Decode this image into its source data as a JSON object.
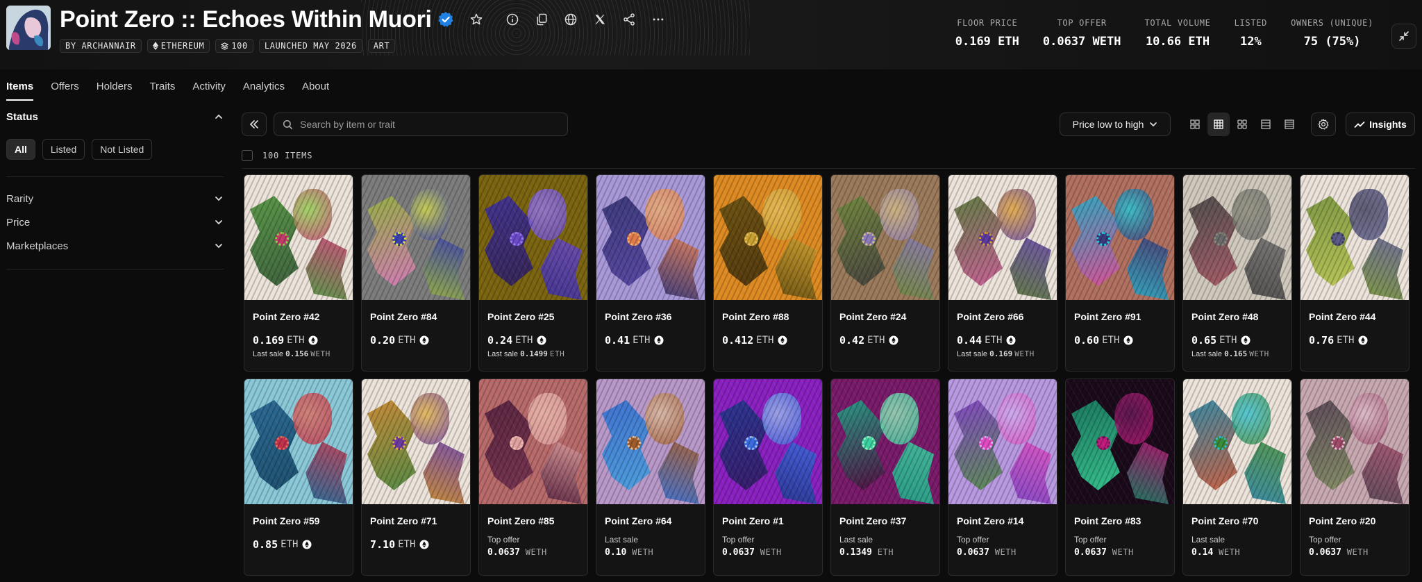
{
  "collection": {
    "title": "Point Zero :: Echoes Within Muori",
    "tags": [
      {
        "label": "BY ARCHANNAIR",
        "icon": ""
      },
      {
        "label": "ETHEREUM",
        "icon": "ethereum-icon"
      },
      {
        "label": "100",
        "icon": "stack-icon"
      },
      {
        "label": "LAUNCHED MAY 2026",
        "icon": ""
      },
      {
        "label": "ART",
        "icon": ""
      }
    ]
  },
  "stats": [
    {
      "label": "FLOOR PRICE",
      "value": "0.169 ETH"
    },
    {
      "label": "TOP OFFER",
      "value": "0.0637 WETH"
    },
    {
      "label": "TOTAL VOLUME",
      "value": "10.66 ETH"
    },
    {
      "label": "LISTED",
      "value": "12%"
    },
    {
      "label": "OWNERS (UNIQUE)",
      "value": "75 (75%)"
    }
  ],
  "tabs": [
    "Items",
    "Offers",
    "Holders",
    "Traits",
    "Activity",
    "Analytics",
    "About"
  ],
  "active_tab": "Items",
  "sidebar": {
    "status_title": "Status",
    "status_chips": [
      "All",
      "Listed",
      "Not Listed"
    ],
    "active_chip": "All",
    "filters": [
      "Rarity",
      "Price",
      "Marketplaces"
    ]
  },
  "toolbar": {
    "search_placeholder": "Search by item or trait",
    "sort_label": "Price low to high",
    "insights_label": "Insights",
    "items_count": "100 ITEMS"
  },
  "items": [
    {
      "name": "Point Zero #42",
      "kind": "listed",
      "price": "0.169",
      "unit": "ETH",
      "sub_label": "Last sale",
      "sub_value": "0.156",
      "sub_unit": "WETH",
      "palette": [
        "#ece3da",
        "#3f8a2e",
        "#c23a6a",
        "#1f4a22",
        "#8fd04a"
      ]
    },
    {
      "name": "Point Zero #84",
      "kind": "listed",
      "price": "0.20",
      "unit": "ETH",
      "palette": [
        "#7c7c7c",
        "#9ab83a",
        "#3a3fb0",
        "#e07ac0",
        "#d8e04a"
      ]
    },
    {
      "name": "Point Zero #25",
      "kind": "listed",
      "price": "0.24",
      "unit": "ETH",
      "sub_label": "Last sale",
      "sub_value": "0.1499",
      "sub_unit": "ETH",
      "palette": [
        "#7a6410",
        "#3a2ca8",
        "#6a4ac8",
        "#2a1a60",
        "#9a7cf0"
      ]
    },
    {
      "name": "Point Zero #36",
      "kind": "listed",
      "price": "0.41",
      "unit": "ETH",
      "palette": [
        "#a898d8",
        "#2a2a6a",
        "#e07a4a",
        "#4a3a9a",
        "#f0b070"
      ]
    },
    {
      "name": "Point Zero #88",
      "kind": "listed",
      "price": "0.412",
      "unit": "ETH",
      "palette": [
        "#de8a22",
        "#5a4a10",
        "#c8a030",
        "#3a2a0a",
        "#e8c060"
      ]
    },
    {
      "name": "Point Zero #24",
      "kind": "listed",
      "price": "0.42",
      "unit": "ETH",
      "palette": [
        "#9a7a5a",
        "#6a8a3a",
        "#8a7ab8",
        "#3a3a3a",
        "#d8c08a"
      ]
    },
    {
      "name": "Point Zero #66",
      "kind": "listed",
      "price": "0.44",
      "unit": "ETH",
      "sub_label": "Last sale",
      "sub_value": "0.169",
      "sub_unit": "WETH",
      "palette": [
        "#ece3da",
        "#4a6a2a",
        "#5a3aa0",
        "#c04a8a",
        "#e0a030"
      ]
    },
    {
      "name": "Point Zero #91",
      "kind": "listed",
      "price": "0.60",
      "unit": "ETH",
      "palette": [
        "#b07060",
        "#1ab0d0",
        "#3a3a7a",
        "#e04aa0",
        "#20d0e0"
      ]
    },
    {
      "name": "Point Zero #48",
      "kind": "listed",
      "price": "0.65",
      "unit": "ETH",
      "sub_label": "Last sale",
      "sub_value": "0.165",
      "sub_unit": "WETH",
      "palette": [
        "#cfc8bc",
        "#3a3a3a",
        "#6a6a6a",
        "#a04a5a",
        "#8a8a7a"
      ]
    },
    {
      "name": "Point Zero #44",
      "kind": "listed",
      "price": "0.76",
      "unit": "ETH",
      "palette": [
        "#ece3da",
        "#6a8a2a",
        "#5a5a8a",
        "#b0c040",
        "#3a3a5a"
      ]
    },
    {
      "name": "Point Zero #59",
      "kind": "listed",
      "price": "0.85",
      "unit": "ETH",
      "palette": [
        "#8ac8d8",
        "#1a5a8a",
        "#c0304a",
        "#0a3a5a",
        "#e07060"
      ]
    },
    {
      "name": "Point Zero #71",
      "kind": "listed",
      "price": "7.10",
      "unit": "ETH",
      "palette": [
        "#ece3da",
        "#c07a1a",
        "#6a3aa0",
        "#3a7a2a",
        "#e0b040"
      ]
    },
    {
      "name": "Point Zero #85",
      "kind": "offer",
      "offer_label": "Top offer",
      "offer_value": "0.0637",
      "offer_unit": "WETH",
      "palette": [
        "#b86a6a",
        "#4a1a3a",
        "#e0a0a0",
        "#6a2a4a",
        "#f0c0b0"
      ]
    },
    {
      "name": "Point Zero #64",
      "kind": "offer",
      "offer_label": "Last sale",
      "offer_value": "0.10",
      "offer_unit": "WETH",
      "palette": [
        "#b898c8",
        "#2a6ad0",
        "#a05a2a",
        "#3aa0e0",
        "#e0c0a0"
      ]
    },
    {
      "name": "Point Zero #1",
      "kind": "offer",
      "offer_label": "Top offer",
      "offer_value": "0.0637",
      "offer_unit": "WETH",
      "palette": [
        "#8a20c0",
        "#1a3a8a",
        "#3a6ae0",
        "#2a1a5a",
        "#a0c0f0"
      ]
    },
    {
      "name": "Point Zero #37",
      "kind": "offer",
      "offer_label": "Last sale",
      "offer_value": "0.1349",
      "offer_unit": "ETH",
      "palette": [
        "#7a1a6a",
        "#1ab08a",
        "#3ad0a0",
        "#4a0a3a",
        "#9af0c0"
      ]
    },
    {
      "name": "Point Zero #14",
      "kind": "offer",
      "offer_label": "Top offer",
      "offer_value": "0.0637",
      "offer_unit": "WETH",
      "palette": [
        "#b898e0",
        "#7a3ac0",
        "#e04ac0",
        "#4a8a3a",
        "#d0b0f0"
      ]
    },
    {
      "name": "Point Zero #83",
      "kind": "offer",
      "offer_label": "Top offer",
      "offer_value": "0.0637",
      "offer_unit": "WETH",
      "palette": [
        "#1a0a1a",
        "#1a8a6a",
        "#c01a7a",
        "#3ae0a0",
        "#6a1a5a"
      ]
    },
    {
      "name": "Point Zero #70",
      "kind": "offer",
      "offer_label": "Last sale",
      "offer_value": "0.14",
      "offer_unit": "WETH",
      "palette": [
        "#ece3da",
        "#1a7a9a",
        "#3a8a3a",
        "#c04a2a",
        "#30c0d0"
      ]
    },
    {
      "name": "Point Zero #20",
      "kind": "offer",
      "offer_label": "Top offer",
      "offer_value": "0.0637",
      "offer_unit": "WETH",
      "palette": [
        "#c8a8b0",
        "#4a3a4a",
        "#a04a6a",
        "#7a8a5a",
        "#e0c0d0"
      ]
    }
  ]
}
